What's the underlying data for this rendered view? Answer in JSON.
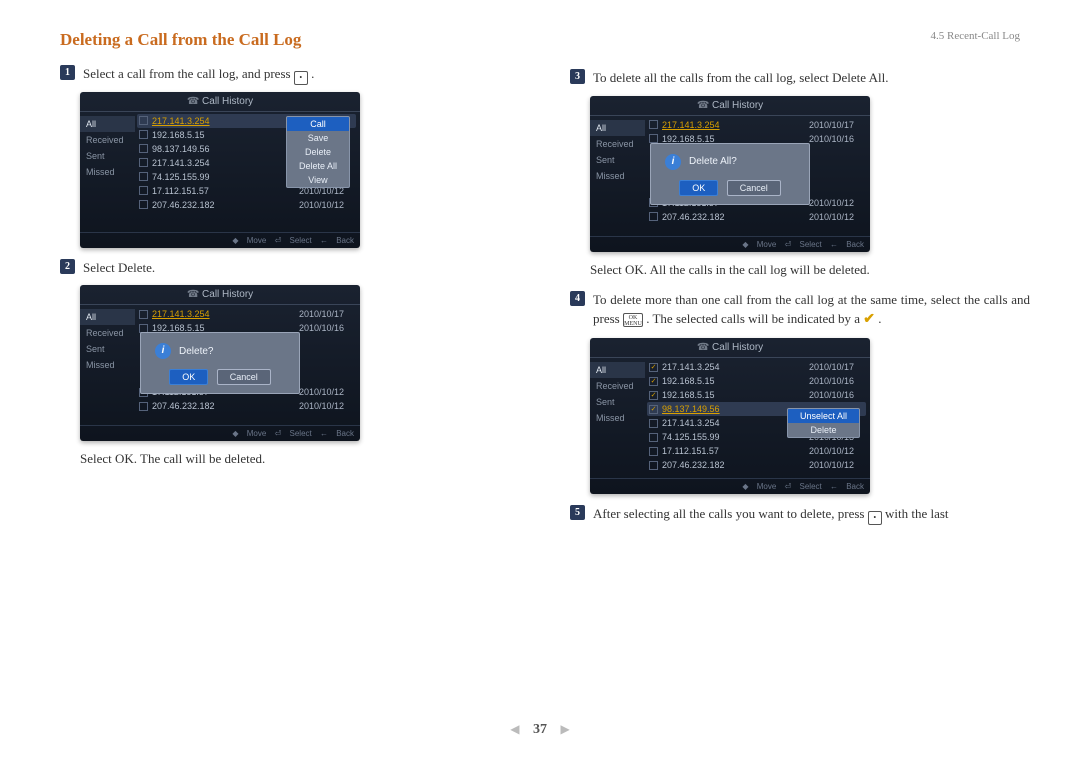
{
  "header": {
    "section": "4.5 Recent-Call Log"
  },
  "title": "Deleting a Call from the Call Log",
  "steps": {
    "s1": {
      "num": "1",
      "text_a": "Select a call from the call log, and press ",
      "text_b": " ."
    },
    "s2": {
      "num": "2",
      "text": "Select Delete."
    },
    "s2_after": "Select OK. The call will be deleted.",
    "s3": {
      "num": "3",
      "text": "To delete all the calls from the call log, select Delete All."
    },
    "s3_after": "Select OK. All the calls in the call log will be deleted.",
    "s4": {
      "num": "4",
      "text_a": "To delete more than one call from the call log at the same time, select the calls and press ",
      "text_b": ". The selected calls will be indicated by a ",
      "text_c": " ."
    },
    "s5": {
      "num": "5",
      "text_a": "After selecting all the calls you want to delete, press ",
      "text_b": " with the last"
    }
  },
  "footer_hints": {
    "move": "Move",
    "select": "Select",
    "back": "Back"
  },
  "sidebar": {
    "all": "All",
    "received": "Received",
    "sent": "Sent",
    "missed": "Missed"
  },
  "shot_title": "Call History",
  "ctx1": {
    "call": "Call",
    "save": "Save",
    "delete": "Delete",
    "delete_all": "Delete All",
    "view": "View"
  },
  "ctx4": {
    "unselect": "Unselect All",
    "delete": "Delete"
  },
  "dlg": {
    "delete_q": "Delete?",
    "delete_all_q": "Delete All?",
    "ok": "OK",
    "cancel": "Cancel"
  },
  "calls_full": [
    {
      "ip": "217.141.3.254",
      "dt": ""
    },
    {
      "ip": "192.168.5.15",
      "dt": ""
    },
    {
      "ip": "98.137.149.56",
      "dt": ""
    },
    {
      "ip": "217.141.3.254",
      "dt": ""
    },
    {
      "ip": "74.125.155.99",
      "dt": "2010/10/13"
    },
    {
      "ip": "17.112.151.57",
      "dt": "2010/10/12"
    },
    {
      "ip": "207.46.232.182",
      "dt": "2010/10/12"
    }
  ],
  "calls_top2": [
    {
      "ip": "217.141.3.254",
      "dt": "2010/10/17"
    },
    {
      "ip": "192.168.5.15",
      "dt": "2010/10/16"
    }
  ],
  "calls_bot2": [
    {
      "ip": "17.112.151.57",
      "dt": "2010/10/12"
    },
    {
      "ip": "207.46.232.182",
      "dt": "2010/10/12"
    }
  ],
  "calls_shot4": [
    {
      "chk": true,
      "ip": "217.141.3.254",
      "dt": "2010/10/17",
      "hl": false
    },
    {
      "chk": true,
      "ip": "192.168.5.15",
      "dt": "2010/10/16",
      "hl": false
    },
    {
      "chk": true,
      "ip": "192.168.5.15",
      "dt": "2010/10/16",
      "hl": false
    },
    {
      "chk": true,
      "ip": "98.137.149.56",
      "dt": "",
      "hl": true
    },
    {
      "chk": false,
      "ip": "217.141.3.254",
      "dt": "",
      "hl": false
    },
    {
      "chk": false,
      "ip": "74.125.155.99",
      "dt": "2010/10/13",
      "hl": false
    },
    {
      "chk": false,
      "ip": "17.112.151.57",
      "dt": "2010/10/12",
      "hl": false
    },
    {
      "chk": false,
      "ip": "207.46.232.182",
      "dt": "2010/10/12",
      "hl": false
    }
  ],
  "page_number": "37"
}
